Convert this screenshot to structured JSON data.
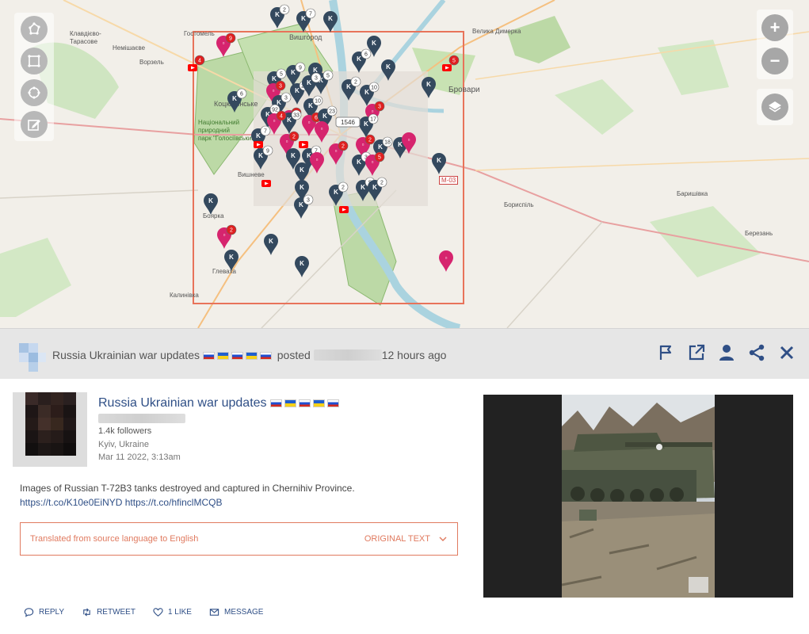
{
  "map": {
    "labels": [
      {
        "text": "Клавдієво-\nТарасове",
        "name": "klavdievo"
      },
      {
        "text": "Немішаєве",
        "name": "nemishaeve"
      },
      {
        "text": "Ворзель",
        "name": "vorzel"
      },
      {
        "text": "Гостомель",
        "name": "hostomel"
      },
      {
        "text": "Вишгород",
        "name": "vyshhorod"
      },
      {
        "text": "Велика Димерка",
        "name": "velyka-dymerka"
      },
      {
        "text": "Бровари",
        "name": "brovary"
      },
      {
        "text": "Коцюбинське",
        "name": "kotsiubynske"
      },
      {
        "text": "Національний\nприродний\nпарк \"Голосіївський\"",
        "name": "holosiivskyi"
      },
      {
        "text": "Вишневе",
        "name": "vyshneve"
      },
      {
        "text": "Боярка",
        "name": "boiarka"
      },
      {
        "text": "Глеваха",
        "name": "hlevakha"
      },
      {
        "text": "Калинівка",
        "name": "kalynivka"
      },
      {
        "text": "Бориспіль",
        "name": "boryspil"
      },
      {
        "text": "Баришівка",
        "name": "baryshivka"
      },
      {
        "text": "Березань",
        "name": "berezan"
      },
      {
        "text": "М-03",
        "name": "m03"
      },
      {
        "text": "Бича",
        "name": "bucha"
      },
      {
        "text": "Ірп",
        "name": "irpin"
      }
    ],
    "cluster_count": "1546",
    "zoom_in": "+",
    "zoom_out": "−"
  },
  "header": {
    "source_name": "Russia Ukrainian war updates",
    "posted": "posted",
    "time": "12 hours ago"
  },
  "post": {
    "author": "Russia Ukrainian war updates",
    "followers": "1.4k followers",
    "location": "Kyiv, Ukraine",
    "date": "Mar 11 2022, 3:13am",
    "text": "Images of Russian T-72B3 tanks destroyed and captured in Chernihiv Province.",
    "link1": "https://t.co/K10e0EiNYD",
    "link2": "https://t.co/hfinclMCQB",
    "translated_note": "Translated from source language to English",
    "original_text": "ORIGINAL TEXT",
    "actions": {
      "reply": "REPLY",
      "retweet": "RETWEET",
      "like": "1 LIKE",
      "message": "MESSAGE"
    }
  },
  "colors": {
    "accent": "#2f4f86",
    "translate": "#e07a5f",
    "selection": "#e8735a",
    "vk_pin": "#34495e",
    "pink_pin": "#d6246e",
    "youtube": "#ff0000"
  }
}
